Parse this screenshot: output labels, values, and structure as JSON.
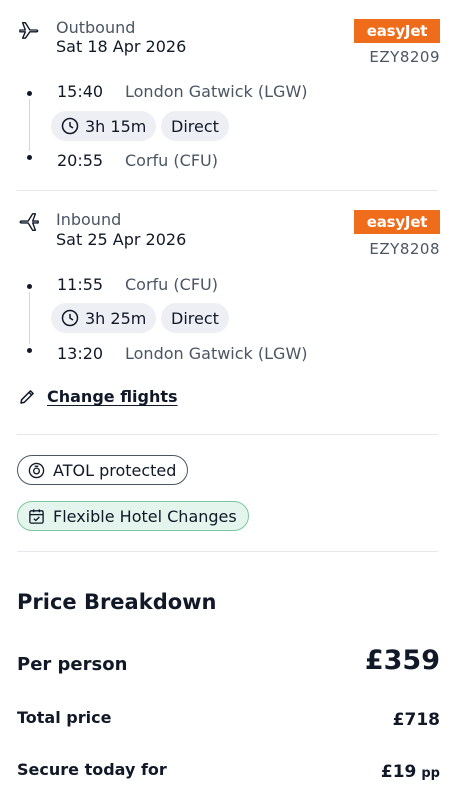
{
  "outbound": {
    "label": "Outbound",
    "date": "Sat 18 Apr 2026",
    "airline": "easyJet",
    "flight_number": "EZY8209",
    "depart_time": "15:40",
    "depart_place": "London Gatwick (LGW)",
    "duration": "3h 15m",
    "stops": "Direct",
    "arrive_time": "20:55",
    "arrive_place": "Corfu (CFU)"
  },
  "inbound": {
    "label": "Inbound",
    "date": "Sat 25 Apr 2026",
    "airline": "easyJet",
    "flight_number": "EZY8208",
    "depart_time": "11:55",
    "depart_place": "Corfu (CFU)",
    "duration": "3h 25m",
    "stops": "Direct",
    "arrive_time": "13:20",
    "arrive_place": "London Gatwick (LGW)"
  },
  "change_flights_label": "Change flights",
  "badges": {
    "atol": "ATOL protected",
    "flexible": "Flexible Hotel Changes"
  },
  "price": {
    "title": "Price Breakdown",
    "per_person_label": "Per person",
    "per_person_value": "£359",
    "total_label": "Total price",
    "total_value": "£718",
    "secure_label": "Secure today for",
    "secure_value": "£19",
    "secure_unit": "pp"
  },
  "colors": {
    "airline_brand": "#ef6c1a",
    "flex_badge_bg": "#e3f5ec",
    "chip_bg": "#eeeff5"
  }
}
